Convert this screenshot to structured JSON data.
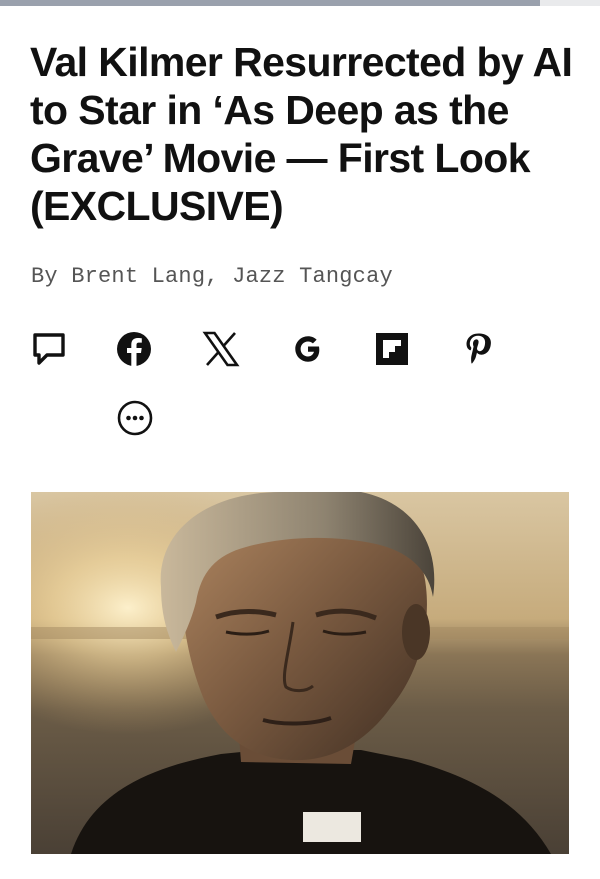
{
  "article": {
    "headline": "Val Kilmer Resurrected by AI to Star in ‘As Deep as the Grave’ Movie — First Look (EXCLUSIVE)",
    "byline_prefix": "By",
    "authors": [
      "Brent Lang",
      "Jazz Tangcay"
    ],
    "author_separator": ","
  },
  "share": {
    "items": [
      {
        "name": "comment",
        "icon": "speech-bubble-icon"
      },
      {
        "name": "facebook",
        "icon": "facebook-icon"
      },
      {
        "name": "x",
        "icon": "x-icon"
      },
      {
        "name": "google",
        "icon": "google-icon"
      },
      {
        "name": "flipboard",
        "icon": "flipboard-icon"
      },
      {
        "name": "pinterest",
        "icon": "pinterest-icon"
      }
    ],
    "more_icon": "more-dots-icon"
  },
  "hero_image": {
    "subject": "man in clerical collar at sunset"
  },
  "colors": {
    "text": "#111111",
    "byline": "#555555",
    "top_bar": "#9aa1ad"
  }
}
